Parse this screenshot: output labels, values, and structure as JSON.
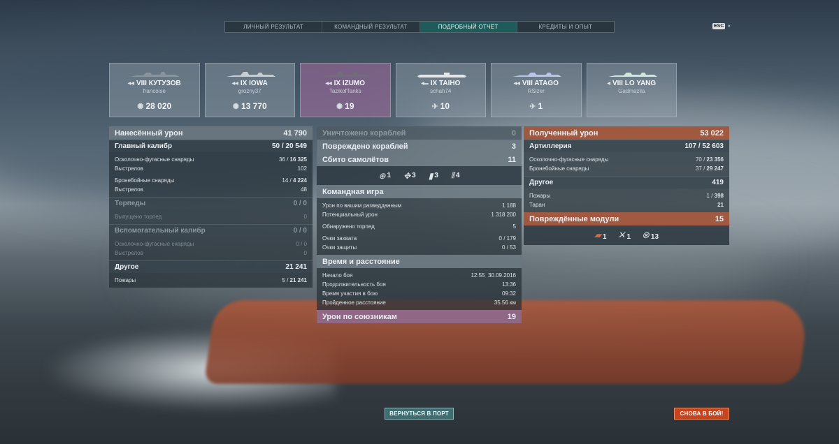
{
  "tabs": [
    "ЛИЧНЫЙ РЕЗУЛЬТАТ",
    "КОМАНДНЫЙ РЕЗУЛЬТАТ",
    "ПОДРОБНЫЙ ОТЧЁТ",
    "КРЕДИТЫ И ОПЫТ"
  ],
  "active_tab": "ПОДРОБНЫЙ ОТЧЁТ",
  "esc": {
    "key": "ESC",
    "close": "×"
  },
  "ships": [
    {
      "name": "VIII КУТУЗОВ",
      "player": "francoise",
      "stat": "28 020",
      "stat_icon": "damage-icon",
      "active": false
    },
    {
      "name": "IX IOWA",
      "player": "grozny37",
      "stat": "13 770",
      "stat_icon": "damage-icon",
      "active": false
    },
    {
      "name": "IX IZUMO",
      "player": "TazikofTanks",
      "stat": "19",
      "stat_icon": "damage-icon",
      "active": true
    },
    {
      "name": "IX TAIHO",
      "player": "schah74",
      "stat": "10",
      "stat_icon": "plane-kill-icon",
      "active": false
    },
    {
      "name": "VIII ATAGO",
      "player": "RSizer",
      "stat": "1",
      "stat_icon": "plane-kill-icon",
      "active": false
    },
    {
      "name": "VIII LO YANG",
      "player": "Gadmazila",
      "stat": "",
      "stat_icon": "",
      "active": false
    }
  ],
  "left": {
    "damage_dealt": {
      "label": "Нанесённый урон",
      "value": "41 790"
    },
    "main_battery": {
      "label": "Главный калибр",
      "hits": "50",
      "total": "20 549"
    },
    "he_shells": {
      "label": "Осколочно-фугасные снаряды",
      "hits": "36",
      "total": "16 325"
    },
    "he_fired": {
      "label": "Выстрелов",
      "value": "102"
    },
    "ap_shells": {
      "label": "Бронебойные снаряды",
      "hits": "14",
      "total": "4 224"
    },
    "ap_fired": {
      "label": "Выстрелов",
      "value": "48"
    },
    "torpedoes": {
      "label": "Торпеды",
      "value": "0 / 0"
    },
    "torp_fired": {
      "label": "Выпущено торпед",
      "value": "0"
    },
    "secondary": {
      "label": "Вспомогательный калибр",
      "value": "0 / 0"
    },
    "sec_he": {
      "label": "Осколочно-фугасные снаряды",
      "value": "0 / 0"
    },
    "sec_fired": {
      "label": "Выстрелов",
      "value": "0"
    },
    "other": {
      "label": "Другое",
      "value": "21 241"
    },
    "fires": {
      "label": "Пожары",
      "hits": "5",
      "total": "21 241"
    }
  },
  "mid": {
    "ships_destroyed": {
      "label": "Уничтожено кораблей",
      "value": "0"
    },
    "ships_damaged": {
      "label": "Повреждено кораблей",
      "value": "3"
    },
    "planes_shot": {
      "label": "Сбито самолётов",
      "value": "11"
    },
    "planes": [
      {
        "icon": "fighter-icon",
        "value": "1"
      },
      {
        "icon": "spotter-icon",
        "value": "3"
      },
      {
        "icon": "bomber-icon",
        "value": "3"
      },
      {
        "icon": "torpedo-bomber-icon",
        "value": "4"
      }
    ],
    "team_play": {
      "label": "Командная игра"
    },
    "spotting_damage": {
      "label": "Урон по вашим разведданным",
      "value": "1 188"
    },
    "potential_damage": {
      "label": "Потенциальный урон",
      "value": "1 318 200"
    },
    "torps_spotted": {
      "label": "Обнаружено торпед",
      "value": "5"
    },
    "capture_pts": {
      "label": "Очки захвата",
      "value": "0 / 179"
    },
    "defense_pts": {
      "label": "Очки защиты",
      "value": "0 / 53"
    },
    "time_dist": {
      "label": "Время и расстояние"
    },
    "battle_start": {
      "label": "Начало боя",
      "time": "12:55",
      "date": "30.09.2016"
    },
    "battle_duration": {
      "label": "Продолжительность боя",
      "value": "13:36"
    },
    "time_in_battle": {
      "label": "Время участия в бою",
      "value": "09:32"
    },
    "distance": {
      "label": "Пройденное расстояние",
      "value": "35.56 км"
    },
    "ally_damage": {
      "label": "Урон по союзникам",
      "value": "19"
    }
  },
  "right": {
    "damage_received": {
      "label": "Полученный урон",
      "value": "53 022"
    },
    "artillery": {
      "label": "Артиллерия",
      "hits": "107",
      "total": "52 603"
    },
    "he_shells": {
      "label": "Осколочно-фугасные снаряды",
      "hits": "70",
      "total": "23 356"
    },
    "ap_shells": {
      "label": "Бронебойные снаряды",
      "hits": "37",
      "total": "29 247"
    },
    "other": {
      "label": "Другое",
      "value": "419"
    },
    "fires": {
      "label": "Пожары",
      "hits": "1",
      "total": "398"
    },
    "ram": {
      "label": "Таран",
      "value": "21"
    },
    "modules": {
      "label": "Повреждённые модули",
      "value": "15"
    },
    "module_icons": [
      {
        "icon": "guns-icon",
        "value": "1"
      },
      {
        "icon": "aa-destroyed-icon",
        "value": "1"
      },
      {
        "icon": "secondary-destroyed-icon",
        "value": "13"
      }
    ]
  },
  "buttons": {
    "port": "ВЕРНУТЬСЯ В ПОРТ",
    "battle": "СНОВА В БОЙ!"
  },
  "colors": {
    "accent_tab": "#1f5b5a",
    "damage_red": "#b25c3e",
    "ally_pink": "#aa78a0",
    "battle_button": "#c6441f",
    "port_button": "#3f6d72"
  }
}
